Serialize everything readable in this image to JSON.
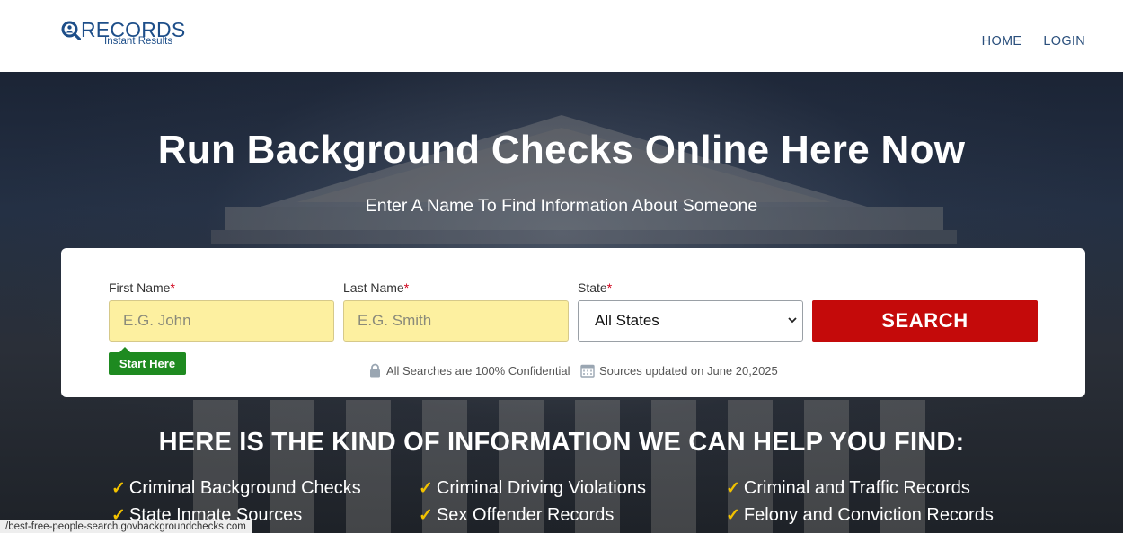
{
  "header": {
    "logo_brand": "RECORDS",
    "logo_tagline": "Instant Results",
    "nav": [
      {
        "label": "HOME"
      },
      {
        "label": "LOGIN"
      }
    ]
  },
  "hero": {
    "title": "Run Background Checks Online Here Now",
    "subtitle": "Enter A Name To Find Information About Someone"
  },
  "search_form": {
    "first_name_label": "First Name",
    "last_name_label": "Last Name",
    "state_label": "State",
    "required_marker": "*",
    "first_name_placeholder": "E.G. John",
    "last_name_placeholder": "E.G. Smith",
    "state_value": "All States",
    "search_label": "SEARCH",
    "start_here": "Start Here",
    "confidential_note": "All Searches are 100% Confidential",
    "updated_note": "Sources updated on June 20,2025"
  },
  "info": {
    "title": "HERE IS THE KIND OF INFORMATION WE CAN HELP YOU FIND:",
    "items": [
      "Criminal Background Checks",
      "Criminal Driving Violations",
      "Criminal and Traffic Records",
      "State Inmate Sources",
      "Sex Offender Records",
      "Felony and Conviction Records"
    ]
  },
  "status_bar": {
    "url": "/best-free-people-search.govbackgroundchecks.com"
  },
  "colors": {
    "brand_blue": "#1d4e89",
    "search_red": "#c40a0a",
    "input_yellow": "#fdf0a0",
    "start_green": "#1e8a20",
    "check_gold": "#f2c200"
  }
}
